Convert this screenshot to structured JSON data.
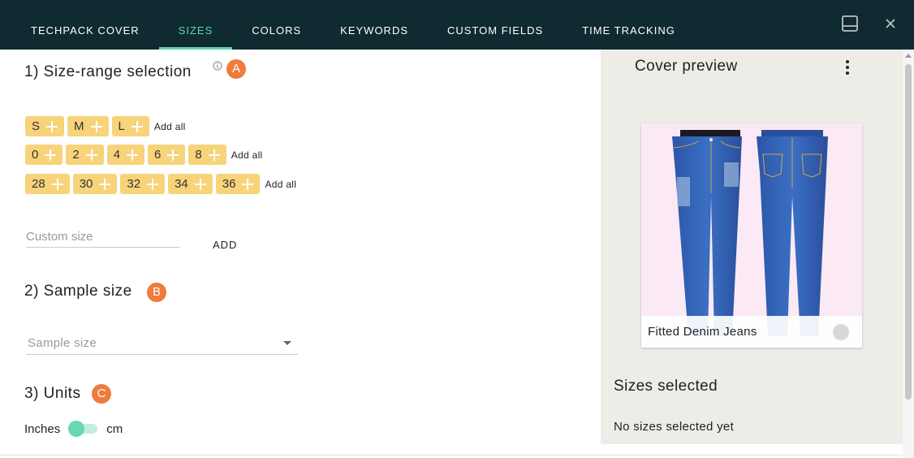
{
  "tabs": [
    {
      "label": "TECHPACK COVER",
      "active": false
    },
    {
      "label": "SIZES",
      "active": true
    },
    {
      "label": "COLORS",
      "active": false
    },
    {
      "label": "KEYWORDS",
      "active": false
    },
    {
      "label": "CUSTOM FIELDS",
      "active": false
    },
    {
      "label": "TIME TRACKING",
      "active": false
    }
  ],
  "icons": {
    "layout": "panel-layout-icon",
    "close": "close-icon",
    "info": "info-icon",
    "menu": "more-vertical-icon"
  },
  "colors": {
    "topbar": "#0f2a30",
    "accent": "#5fd4b4",
    "chip": "#f7d37a",
    "badge": "#ef7b3d",
    "panel": "#eeece6"
  },
  "size_range": {
    "title": "1) Size-range selection",
    "badge": "A",
    "groups": [
      {
        "sizes": [
          "S",
          "M",
          "L"
        ],
        "add_all": "Add all"
      },
      {
        "sizes": [
          "0",
          "2",
          "4",
          "6",
          "8"
        ],
        "add_all": "Add all"
      },
      {
        "sizes": [
          "28",
          "30",
          "32",
          "34",
          "36"
        ],
        "add_all": "Add all"
      }
    ],
    "custom_placeholder": "Custom size",
    "custom_value": "",
    "add_label": "ADD"
  },
  "sample_size": {
    "title": "2) Sample size",
    "badge": "B",
    "placeholder": "Sample size"
  },
  "units": {
    "title": "3) Units",
    "badge": "C",
    "left_label": "Inches",
    "right_label": "cm",
    "selected": "Inches"
  },
  "preview": {
    "title": "Cover preview",
    "product_name": "Fitted Denim Jeans",
    "sizes_title": "Sizes selected",
    "sizes_empty": "No sizes selected yet"
  }
}
